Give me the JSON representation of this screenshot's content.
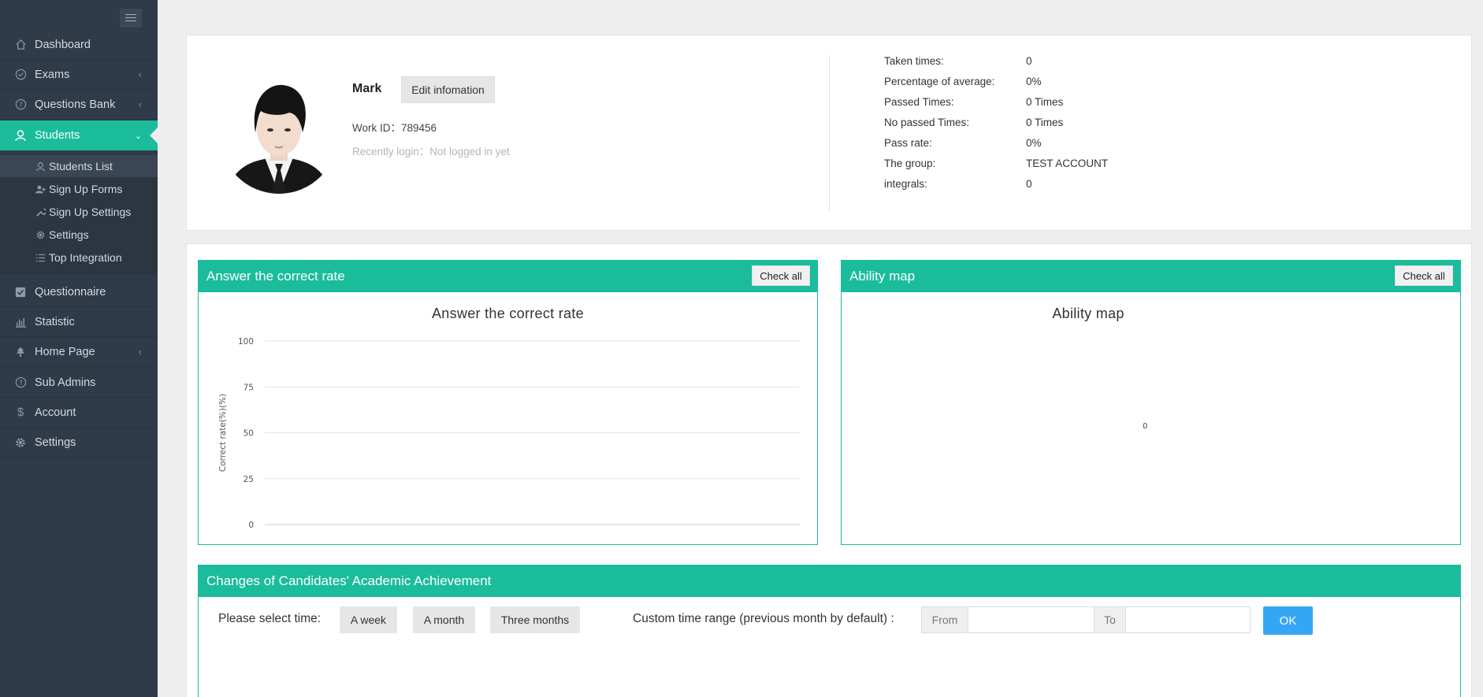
{
  "sidebar": {
    "items": [
      {
        "label": "Dashboard",
        "icon": "home-icon",
        "expandable": false
      },
      {
        "label": "Exams",
        "icon": "check-circle-icon",
        "expandable": true
      },
      {
        "label": "Questions Bank",
        "icon": "question-circle-icon",
        "expandable": true
      },
      {
        "label": "Students",
        "icon": "students-icon",
        "expandable": true,
        "active": true
      },
      {
        "label": "Questionnaire",
        "icon": "checkbox-icon",
        "expandable": false
      },
      {
        "label": "Statistic",
        "icon": "bar-chart-icon",
        "expandable": false
      },
      {
        "label": "Home Page",
        "icon": "tree-icon",
        "expandable": true
      },
      {
        "label": "Sub Admins",
        "icon": "question-circle-icon",
        "expandable": false
      },
      {
        "label": "Account",
        "icon": "dollar-icon",
        "expandable": false
      },
      {
        "label": "Settings",
        "icon": "gear-icon",
        "expandable": false
      }
    ],
    "submenu": [
      {
        "label": "Students List",
        "icon": "user-icon",
        "active": true
      },
      {
        "label": "Sign Up Forms",
        "icon": "add-user-icon"
      },
      {
        "label": "Sign Up Settings",
        "icon": "wrench-icon"
      },
      {
        "label": "Settings",
        "icon": "gear-icon"
      },
      {
        "label": "Top Integration",
        "icon": "list-icon"
      }
    ]
  },
  "profile": {
    "name": "Mark",
    "edit_label": "Edit infomation",
    "work_id_label": "Work ID：",
    "work_id": "789456",
    "recent_login_label": "Recently login：",
    "recent_login": "Not logged in yet",
    "stats": [
      {
        "label": "Taken times:",
        "value": "0"
      },
      {
        "label": "Percentage of average:",
        "value": "0%"
      },
      {
        "label": "Passed Times:",
        "value": "0 Times"
      },
      {
        "label": "No passed Times:",
        "value": "0 Times"
      },
      {
        "label": "Pass rate:",
        "value": "0%"
      },
      {
        "label": "The group:",
        "value": "TEST ACCOUNT"
      },
      {
        "label": "integrals:",
        "value": "0"
      }
    ]
  },
  "correct_rate_panel": {
    "header": "Answer the correct rate",
    "check_all": "Check all"
  },
  "ability_panel": {
    "header": "Ability map",
    "check_all": "Check all"
  },
  "chart_data": [
    {
      "type": "line",
      "title": "Answer the correct rate",
      "xlabel": "",
      "ylabel": "Correct rate(%)(%)",
      "ylim": [
        0,
        100
      ],
      "yticks": [
        "100",
        "75",
        "50",
        "25",
        "0"
      ],
      "series": [],
      "grid": true
    },
    {
      "type": "radar",
      "title": "Ability map",
      "center_label": "0",
      "series": []
    }
  ],
  "achievement": {
    "header": "Changes of Candidates' Academic Achievement",
    "select_time_label": "Please select time:",
    "btn_week": "A week",
    "btn_month": "A month",
    "btn_three_months": "Three months",
    "custom_range_label": "Custom time range (previous month by default) :",
    "from_label": "From",
    "to_label": "To",
    "ok_label": "OK"
  },
  "colors": {
    "accent": "#1abc9c",
    "sidebar_bg": "#2f3b48",
    "ok_button": "#35a6f3"
  }
}
